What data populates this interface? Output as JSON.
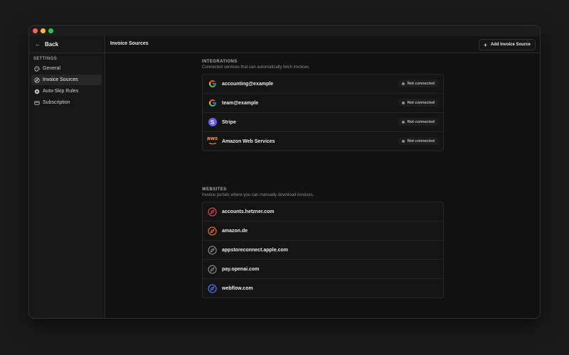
{
  "sidebar": {
    "back_label": "Back",
    "section_heading": "SETTINGS",
    "items": [
      {
        "label": "General",
        "icon": "palette-icon",
        "active": false
      },
      {
        "label": "Invoice Sources",
        "icon": "compass-icon",
        "active": true
      },
      {
        "label": "Auto-Skip Rules",
        "icon": "x-circle-icon",
        "active": false
      },
      {
        "label": "Subscription",
        "icon": "credit-card-icon",
        "active": false
      }
    ]
  },
  "header": {
    "title": "Invoice Sources",
    "add_button_label": "Add Invoice Source"
  },
  "integrations": {
    "title": "INTEGRATIONS",
    "subtitle": "Connected services that can automatically fetch invoices.",
    "items": [
      {
        "name": "accounting@example",
        "icon": "google-icon",
        "status": "Not connected"
      },
      {
        "name": "team@example",
        "icon": "google-icon",
        "status": "Not connected"
      },
      {
        "name": "Stripe",
        "icon": "stripe-icon",
        "status": "Not connected",
        "logo_text": "S"
      },
      {
        "name": "Amazon Web Services",
        "icon": "aws-icon",
        "status": "Not connected",
        "logo_text": "aws"
      }
    ]
  },
  "websites": {
    "title": "WEBSITES",
    "subtitle": "Invoice portals where you can manually download invoices.",
    "items": [
      {
        "name": "accounts.hetzner.com",
        "icon": "compass-icon",
        "color": "#e5484d"
      },
      {
        "name": "amazon.de",
        "icon": "compass-icon",
        "color": "#f2711c"
      },
      {
        "name": "appstoreconnect.apple.com",
        "icon": "compass-icon",
        "color": "#8a8a8a"
      },
      {
        "name": "pay.openai.com",
        "icon": "compass-icon",
        "color": "#8a8a8a"
      },
      {
        "name": "webflow.com",
        "icon": "compass-icon",
        "color": "#4d7cff"
      }
    ]
  },
  "colors": {
    "window_traffic_close": "#fe5f57",
    "window_traffic_minimize": "#febc2e",
    "window_traffic_zoom": "#28c840",
    "status_dot": "#8a8a8a"
  }
}
